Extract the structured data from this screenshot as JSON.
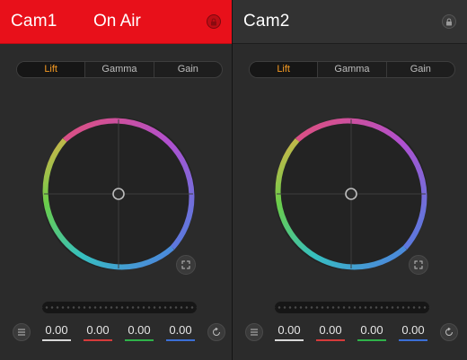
{
  "colors": {
    "on_air": "#e8101a",
    "active_tab": "#f59a22",
    "luma": "#d9d9d9",
    "red": "#d63b3b",
    "green": "#2fb24a",
    "blue": "#3b6fd6"
  },
  "panels": [
    {
      "camera": "Cam1",
      "status": "On Air",
      "tabs": [
        "Lift",
        "Gamma",
        "Gain"
      ],
      "active_tab": "Lift",
      "values": {
        "luma": "0.00",
        "red": "0.00",
        "green": "0.00",
        "blue": "0.00"
      },
      "icons": {
        "lock": "lock-icon",
        "expand": "expand-icon",
        "menu": "menu-icon",
        "reset": "reset-icon"
      }
    },
    {
      "camera": "Cam2",
      "status": "",
      "tabs": [
        "Lift",
        "Gamma",
        "Gain"
      ],
      "active_tab": "Lift",
      "values": {
        "luma": "0.00",
        "red": "0.00",
        "green": "0.00",
        "blue": "0.00"
      },
      "icons": {
        "lock": "lock-icon",
        "expand": "expand-icon",
        "menu": "menu-icon",
        "reset": "reset-icon"
      }
    }
  ]
}
